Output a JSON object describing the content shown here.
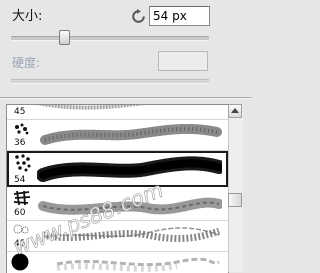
{
  "size": {
    "label": "大小:",
    "value": "54 px",
    "slider_fraction": 0.28
  },
  "hardness": {
    "label": "硬度:",
    "value": ""
  },
  "brushes": [
    {
      "size": "45"
    },
    {
      "size": "36"
    },
    {
      "size": "54",
      "selected": true
    },
    {
      "size": "60"
    },
    {
      "size": "45"
    },
    {
      "size": ""
    }
  ],
  "watermark": "www.ps88.com"
}
